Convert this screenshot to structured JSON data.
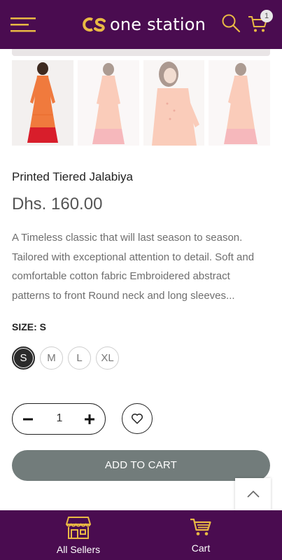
{
  "header": {
    "logo_text": "one station",
    "cart_count": "1",
    "accent_color": "#e9b944",
    "background_color": "#4a0c50",
    "icons": [
      "menu-icon",
      "logo-icon",
      "search-icon",
      "cart-icon"
    ]
  },
  "product": {
    "title": "Printed Tiered Jalabiya",
    "price": "Dhs. 160.00",
    "description": "A Timeless classic that will last season to season. Tailored with exceptional attention to detail.   Soft and comfortable cotton fabric Embroidered abstract patterns to front Round neck and long sleeves...",
    "thumbnail_count": 4
  },
  "size": {
    "label": "SIZE: S",
    "options": [
      "S",
      "M",
      "L",
      "XL"
    ],
    "selected": "S"
  },
  "quantity": {
    "value": "1"
  },
  "actions": {
    "add_to_cart_label": "ADD TO CART",
    "add_to_cart_color": "#727c7b"
  },
  "bottom_nav": {
    "items": [
      {
        "label": "All Sellers",
        "icon": "store-icon"
      },
      {
        "label": "Cart",
        "icon": "cart-icon"
      }
    ]
  }
}
